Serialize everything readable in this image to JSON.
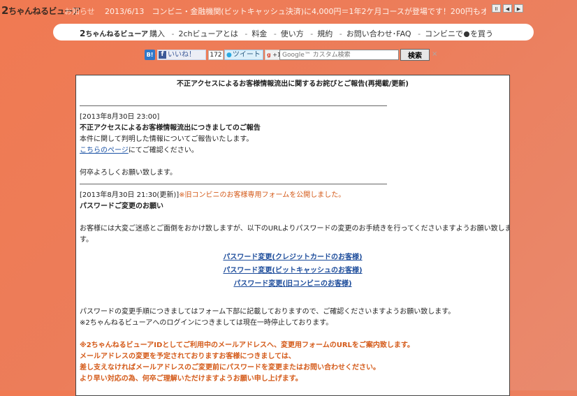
{
  "topbar": {
    "logo_num": "2",
    "logo_text": "ちゃんねるビューア",
    "news_label": "お知らせ",
    "ticker": "2013/6/13　コンビニ・金融機関(ビットキャッシュ決済)に4,000円＝1年2ケ月コースが登場です！200円もオト",
    "controls": [
      "II",
      "◀",
      "▶"
    ]
  },
  "nav": {
    "logo_num": "2",
    "logo_text": "ちゃんねるビューア",
    "items": [
      "購入",
      "2chビューアとは",
      "料金",
      "使い方",
      "規約",
      "お問い合わせ･FAQ"
    ],
    "last_prefix": "コンビニで",
    "last_suffix": "を買う"
  },
  "social": {
    "hatena": "B!",
    "like_icon": "f",
    "like": "いいね！",
    "like_count": "172",
    "tweet": "ツイート",
    "gplus": "+1"
  },
  "search": {
    "placeholder": "Google™ カスタム検索",
    "button": "検索",
    "clear": "×"
  },
  "article": {
    "title": "不正アクセスによるお客様情報流出に関するお詫びとご報告(再掲載/更新)",
    "s1_date": "[2013年8月30日 23:00]",
    "s1_heading": "不正アクセスによるお客様情報流出につきましてのご報告",
    "s1_text": "本件に関して判明した情報についてご報告いたします。",
    "s1_link": "こちらのページ",
    "s1_link_suffix": "にてご確認ください。",
    "s1_closing": "何卒よろしくお願い致します。",
    "s2_date": "[2013年8月30日 21:30(更新)]",
    "s2_notice": "※旧コンビニのお客様専用フォームを公開しました。",
    "s2_heading": "パスワードご変更のお願い",
    "s2_text1": "お客様には大変ご迷惑とご面倒をおかけ致しますが、以下のURLよりパスワードの変更のお手続きを行ってくださいますようお願い致しま",
    "s2_text2": "す。",
    "links": [
      "パスワード変更(クレジットカードのお客様)",
      "パスワード変更(ビットキャッシュのお客様)",
      "パスワード変更(旧コンビニのお客様)"
    ],
    "s2_text3": "パスワードの変更手順につきましてはフォーム下部に記載しておりますので、ご確認くださいますようお願い致します。",
    "s2_text4": "※2ちゃんねるビューアへのログインにつきましては現在一時停止しております。",
    "warn": [
      "※2ちゃんねるビューアIDとしてご利用中のメールアドレスへ、変更用フォームのURLをご案内致します。",
      "メールアドレスの変更を予定されておりますお客様につきましては、",
      "差し支えなければメールアドレスのご変更前にパスワードを変更またはお問い合わせください。",
      "より早い対応の為、何卒ご理解いただけますようお願い申し上げます。"
    ]
  }
}
